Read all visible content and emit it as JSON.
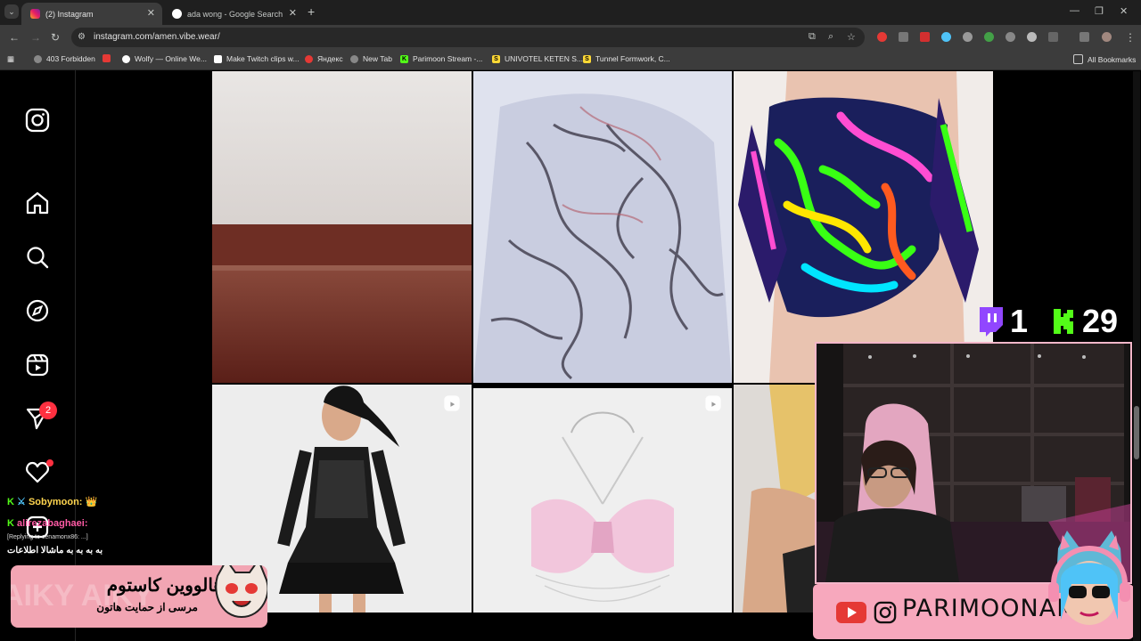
{
  "browser": {
    "tabs": [
      {
        "title": "(2) Instagram",
        "active": true
      },
      {
        "title": "ada wong - Google Search",
        "active": false
      }
    ],
    "url": "instagram.com/amen.vibe.wear/",
    "bookmarks": [
      {
        "label": "403 Forbidden",
        "icon": "globe-icon"
      },
      {
        "label": "",
        "icon": "youtube-icon"
      },
      {
        "label": "Wolfy — Online We...",
        "icon": "wolfy-icon"
      },
      {
        "label": "Make Twitch clips w...",
        "icon": "clip-icon"
      },
      {
        "label": "Яндекс",
        "icon": "yandex-icon"
      },
      {
        "label": "New Tab",
        "icon": "globe-icon"
      },
      {
        "label": "Parimoon Stream -...",
        "icon": "kick-icon"
      },
      {
        "label": "UNIVOTEL KETEN S...",
        "icon": "s-icon"
      },
      {
        "label": "Tunnel Formwork, C...",
        "icon": "s-icon"
      }
    ],
    "all_bookmarks": "All Bookmarks"
  },
  "instagram": {
    "nav": [
      "instagram-logo",
      "home",
      "search",
      "explore",
      "reels",
      "messages",
      "notifications",
      "create"
    ],
    "messages_badge": "2"
  },
  "overlay": {
    "twitch_count": "1",
    "kick_count": "29",
    "chat": [
      {
        "user": "Sobymoon:",
        "text": ""
      },
      {
        "user": "alirezabaghaei:",
        "text": ""
      },
      {
        "user": "",
        "text": "[Replying to cenamonx86: ...]"
      },
      {
        "user": "",
        "text": "به به به به ماشالا اطلاعات"
      }
    ],
    "banner_title": "هالووین کاستوم",
    "banner_sub": "مرسی از حمایت هاتون",
    "handle": "PARIMOONAM"
  },
  "colors": {
    "accent": "#ff3040",
    "kick": "#53fc18",
    "twitch": "#9146ff",
    "pink": "#f2a5b3"
  }
}
